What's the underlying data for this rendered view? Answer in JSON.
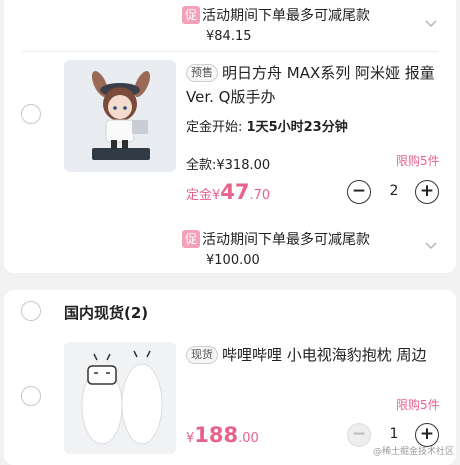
{
  "item1": {
    "promo_tag": "促",
    "promo_text": "活动期间下单最多可减尾款",
    "promo_amount": "¥84.15"
  },
  "item2": {
    "badge": "预售",
    "title": "明日方舟 MAX系列 阿米娅 报童Ver. Q版手办",
    "deposit_start_label": "定金开始:",
    "deposit_start_value": "1天5小时23分钟",
    "full_price": "全款:¥318.00",
    "limit": "限购5件",
    "deposit_label": "定金",
    "currency": "¥",
    "price_int": "47",
    "price_dec": ".70",
    "quantity": "2",
    "promo_tag": "促",
    "promo_text": "活动期间下单最多可减尾款",
    "promo_amount": "¥100.00"
  },
  "section2": {
    "title": "国内现货(2)"
  },
  "item3": {
    "badge": "现货",
    "title": "哔哩哔哩 小电视海豹抱枕 周边",
    "limit": "限购5件",
    "currency": "¥",
    "price_int": "188",
    "price_dec": ".00",
    "quantity": "1"
  },
  "stepper": {
    "minus": "−",
    "plus": "+"
  },
  "watermark": "@稀土掘金技术社区",
  "colors": {
    "accent_pink": "#e8638c",
    "promo_tag_bg": "#f3a0b8",
    "background": "#f2f2f2"
  },
  "icons": [
    "chevron-down-icon",
    "radio-unchecked-icon",
    "minus-icon",
    "plus-icon"
  ]
}
